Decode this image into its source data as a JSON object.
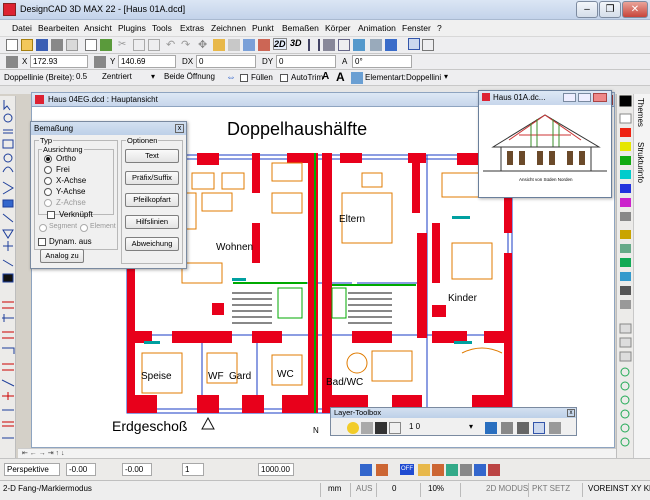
{
  "app": {
    "title": "DesignCAD 3D MAX 22 - [Haus 01A.dcd]"
  },
  "window_controls": {
    "minimize": "–",
    "restore": "❐",
    "close": "✕"
  },
  "menu": [
    "Datei",
    "Bearbeiten",
    "Ansicht",
    "Plugins",
    "Tools",
    "Extras",
    "Zeichnen",
    "Punkt",
    "Bemaßen",
    "Körper",
    "Animation",
    "Fenster",
    "?"
  ],
  "toolbar1": {
    "btn_2d": "2D",
    "btn_3d": "3D"
  },
  "coords": {
    "x_label": "X",
    "x_value": "172.93",
    "y_label": "Y",
    "y_value": "140.69",
    "dx_label": "DX",
    "dx_value": "0",
    "dy_label": "DY",
    "dy_value": "0",
    "a_label": "A",
    "a_value": "0°"
  },
  "line_bar": {
    "label": "Doppellinie (Breite):",
    "width": "0.5",
    "align": "Zentriert",
    "opening": "Beide Öffnung",
    "fill_label": "Füllen",
    "autotrim_label": "AutoTrim",
    "element_label": "Elementart:",
    "element_value": "Doppellini"
  },
  "tabs": {
    "themes": "Themes",
    "struktur": "Strukturinfo"
  },
  "main_window": {
    "title": "Haus 04EG.dcd : Hauptansicht"
  },
  "drawing": {
    "heading": "Doppelhaushälfte",
    "floor": "Erdgeschoß",
    "rooms": [
      "Eltern",
      "Wohnen",
      "Kinder",
      "Speise",
      "WF",
      "Gard",
      "WC",
      "Bad/WC"
    ],
    "axis": "N"
  },
  "dialog": {
    "title": "Bemaßung",
    "type_group": "Typ",
    "align_group": "Ausrichtung",
    "options_group": "Optionen",
    "radios": [
      "Ortho",
      "Frei",
      "X-Achse",
      "Y-Achse",
      "Z-Achse"
    ],
    "segment": "Segment",
    "element": "Element",
    "linked": "Verknüpft",
    "dynamic": "Dynam. aus",
    "analog_btn": "Analog zu",
    "option_buttons": [
      "Text",
      "Präfix/Suffix",
      "Pfeilkopfart",
      "Hilfslinien",
      "Abweichung"
    ]
  },
  "small_window": {
    "title": "Haus 01A.dc...",
    "caption": "Ansicht von Süden Norden"
  },
  "layer_toolbox": {
    "title": "Layer-Toolbox",
    "value": "1 0"
  },
  "view_bar": {
    "view": "Perspektive",
    "v1": "-0.00",
    "v2": "-0.00",
    "v3": "1",
    "v4": "1000.00",
    "off": "OFF"
  },
  "status": {
    "left": "2-D Fang-/Markiermodus",
    "unit": "mm",
    "aus": "AUS",
    "zero": "0",
    "zoom": "10%",
    "mode": "2D MODUS",
    "pkt": "PKT SETZ",
    "voreinst": "VOREINST XY KE"
  },
  "colors": {
    "wall": "#e8001b",
    "accent": "#00aa00",
    "furniture": "#e07b00"
  }
}
